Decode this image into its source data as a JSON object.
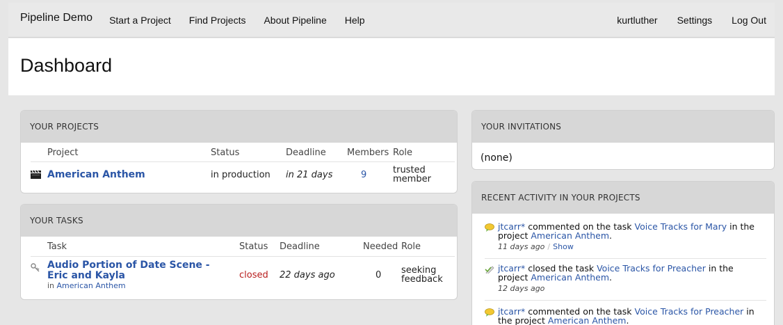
{
  "nav": {
    "brand": "Pipeline Demo",
    "links": [
      "Start a Project",
      "Find Projects",
      "About Pipeline",
      "Help"
    ],
    "user": "kurtluther",
    "settings": "Settings",
    "logout": "Log Out"
  },
  "page": {
    "title": "Dashboard"
  },
  "projects": {
    "header": "YOUR PROJECTS",
    "columns": [
      "Project",
      "Status",
      "Deadline",
      "Members",
      "Role"
    ],
    "rows": [
      {
        "name": "American Anthem",
        "status": "in production",
        "deadline": "in 21 days",
        "members": "9",
        "role_line1": "trusted",
        "role_line2": "member"
      }
    ]
  },
  "tasks": {
    "header": "YOUR TASKS",
    "columns": [
      "Task",
      "Status",
      "Deadline",
      "Needed",
      "Role"
    ],
    "rows": [
      {
        "name_line1": "Audio Portion of Date Scene -",
        "name_line2": "Eric and Kayla",
        "in_label": "in",
        "project": "American Anthem",
        "status": "closed",
        "deadline": "22 days ago",
        "needed": "0",
        "role_line1": "seeking",
        "role_line2": "feedback"
      }
    ]
  },
  "invitations": {
    "header": "YOUR INVITATIONS",
    "empty": "(none)"
  },
  "activity": {
    "header": "RECENT ACTIVITY IN YOUR PROJECTS",
    "items": [
      {
        "user": "jtcarr*",
        "verb": "commented on the task",
        "task": "Voice Tracks for Mary",
        "mid": "in the project",
        "project": "American Anthem",
        "time": "11 days ago",
        "show": "Show"
      },
      {
        "user": "jtcarr*",
        "verb": "closed the task",
        "task": "Voice Tracks for Preacher",
        "mid": "in the project",
        "project": "American Anthem",
        "time": "12 days ago"
      },
      {
        "user": "jtcarr*",
        "verb": "commented on the task",
        "task": "Voice Tracks for Preacher",
        "mid": "in the project",
        "project": "American Anthem"
      }
    ]
  },
  "colors": {
    "link": "#2a55a6",
    "closed": "#b81d1d",
    "header_bg": "#d7d7d7"
  },
  "icons": [
    "clapperboard-icon",
    "key-icon",
    "speech-bubble-icon",
    "checkmark-pencil-icon"
  ]
}
